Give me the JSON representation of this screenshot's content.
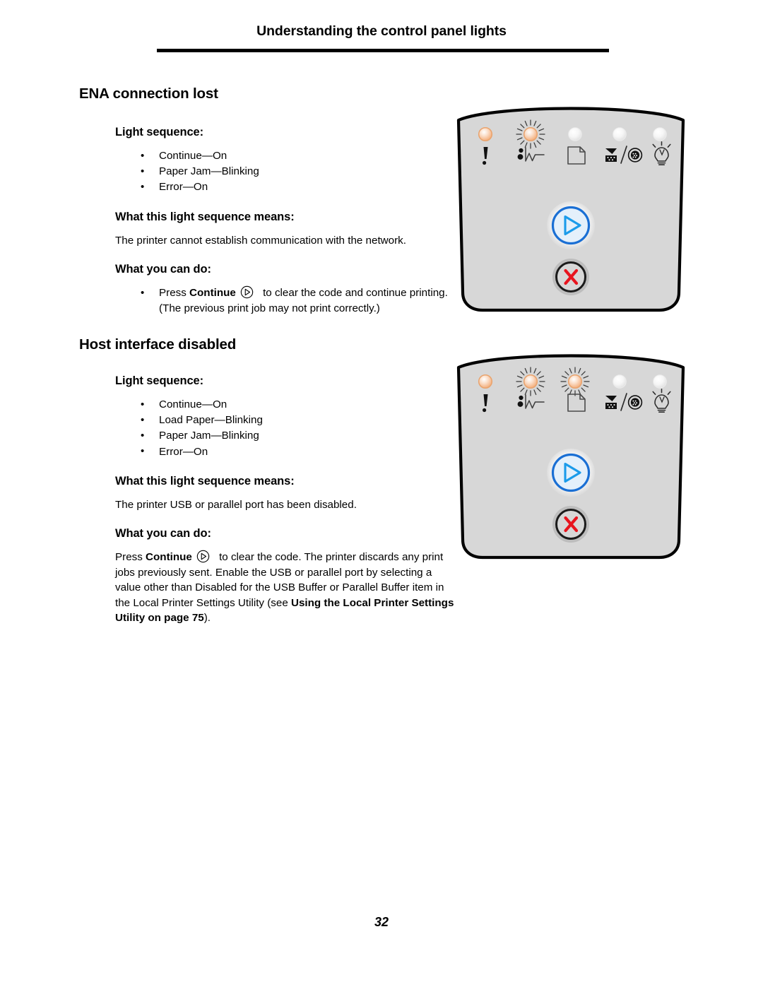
{
  "header": {
    "title": "Understanding the control panel lights"
  },
  "sections": [
    {
      "id": "ena-connection-lost",
      "title": "ENA connection lost",
      "light_sequence_heading": "Light sequence:",
      "light_sequence": [
        "Continue—On",
        "Paper Jam—Blinking",
        "Error—On"
      ],
      "means_heading": "What this light sequence means:",
      "means_text": "The printer cannot establish communication with the network.",
      "action_heading": "What you can do:",
      "action": {
        "prefix": "Press ",
        "bold_label": "Continue",
        "suffix": " to clear the code and continue printing. (The previous print job may not print correctly.)"
      },
      "panel": {
        "leds": [
          {
            "name": "error",
            "state": "on",
            "icon": "exclamation-icon"
          },
          {
            "name": "paper-jam",
            "state": "blinking",
            "icon": "paper-jam-icon"
          },
          {
            "name": "load-paper",
            "state": "off",
            "icon": "paper-sheet-icon"
          },
          {
            "name": "toner",
            "state": "off",
            "icon": "toner-drum-icon"
          },
          {
            "name": "ready",
            "state": "off",
            "icon": "lightbulb-icon"
          }
        ],
        "continue_button": "continue-button",
        "cancel_button": "cancel-button"
      }
    },
    {
      "id": "host-interface-disabled",
      "title": "Host interface disabled",
      "light_sequence_heading": "Light sequence:",
      "light_sequence": [
        "Continue—On",
        "Load Paper—Blinking",
        "Paper Jam—Blinking",
        "Error—On"
      ],
      "means_heading": "What this light sequence means:",
      "means_text": "The printer USB or parallel port has been disabled.",
      "action_heading": "What you can do:",
      "action": {
        "prefix": "Press ",
        "bold_label": "Continue",
        "suffix": " to clear the code. The printer discards any print jobs previously sent. Enable the USB or parallel port by selecting a value other than Disabled for the USB Buffer or Parallel Buffer item in the Local Printer Settings Utility (see ",
        "bold_ref": "Using the Local Printer Settings Utility on page 75",
        "tail": ")."
      },
      "panel": {
        "leds": [
          {
            "name": "error",
            "state": "on",
            "icon": "exclamation-icon"
          },
          {
            "name": "paper-jam",
            "state": "blinking",
            "icon": "paper-jam-icon"
          },
          {
            "name": "load-paper",
            "state": "blinking",
            "icon": "paper-sheet-icon"
          },
          {
            "name": "toner",
            "state": "off",
            "icon": "toner-drum-icon"
          },
          {
            "name": "ready",
            "state": "off",
            "icon": "lightbulb-icon"
          }
        ],
        "continue_button": "continue-button",
        "cancel_button": "cancel-button"
      }
    }
  ],
  "footer": {
    "page_number": "32"
  },
  "colors": {
    "led_on": "#f6c9a4",
    "led_on_rim": "#ef9a5e",
    "led_off": "#f2f2f2",
    "panel_face": "#d7d7d7",
    "panel_outline": "#000000",
    "continue_blue": "#1a6fd4",
    "continue_fill": "#e4f0fb",
    "cancel_red": "#e8141e"
  }
}
